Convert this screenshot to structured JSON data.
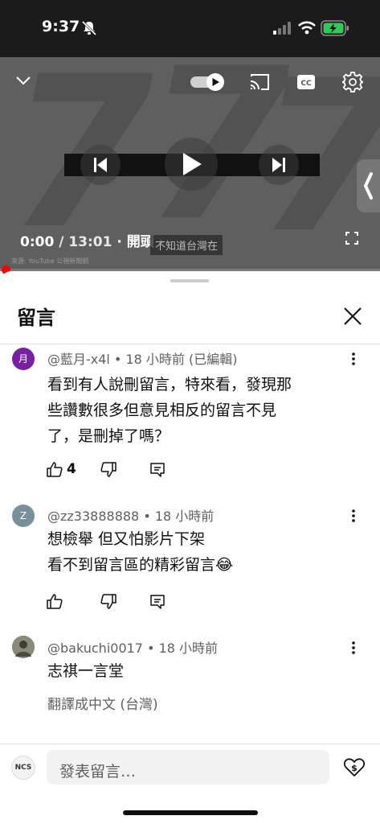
{
  "status_bar": {
    "time": "9:37"
  },
  "video": {
    "current_time": "0:00",
    "total_time": "13:01",
    "chapter": "開頭",
    "overlay_caption": "不知道台灣在",
    "source": "來源: YouTube 公視新聞網"
  },
  "comments_panel": {
    "title": "留言",
    "comments": [
      {
        "avatar_letter": "月",
        "avatar_color": "#7b1fa2",
        "author_meta": "@藍月-x4l • 18 小時前 (已編輯)",
        "lines": [
          "看到有人說刪留言，特來看，發現那",
          "些讚數很多但意見相反的留言不見",
          "了，是刪掉了嗎？"
        ],
        "likes": "4"
      },
      {
        "avatar_letter": "Z",
        "avatar_color": "#78909c",
        "author_meta": "@zz33888888 • 18 小時前",
        "lines": [
          "想檢舉 但又怕影片下架",
          "看不到留言區的精彩留言😂"
        ],
        "likes": ""
      },
      {
        "avatar_letter": "",
        "avatar_color": "#6d6d5e",
        "author_meta": "@bakuchi0017 • 18 小時前",
        "lines": [
          "志祺一言堂"
        ],
        "translate": "翻譯成中文 (台灣)"
      }
    ]
  },
  "input": {
    "placeholder": "發表留言…",
    "user_avatar_text": "NCS"
  }
}
